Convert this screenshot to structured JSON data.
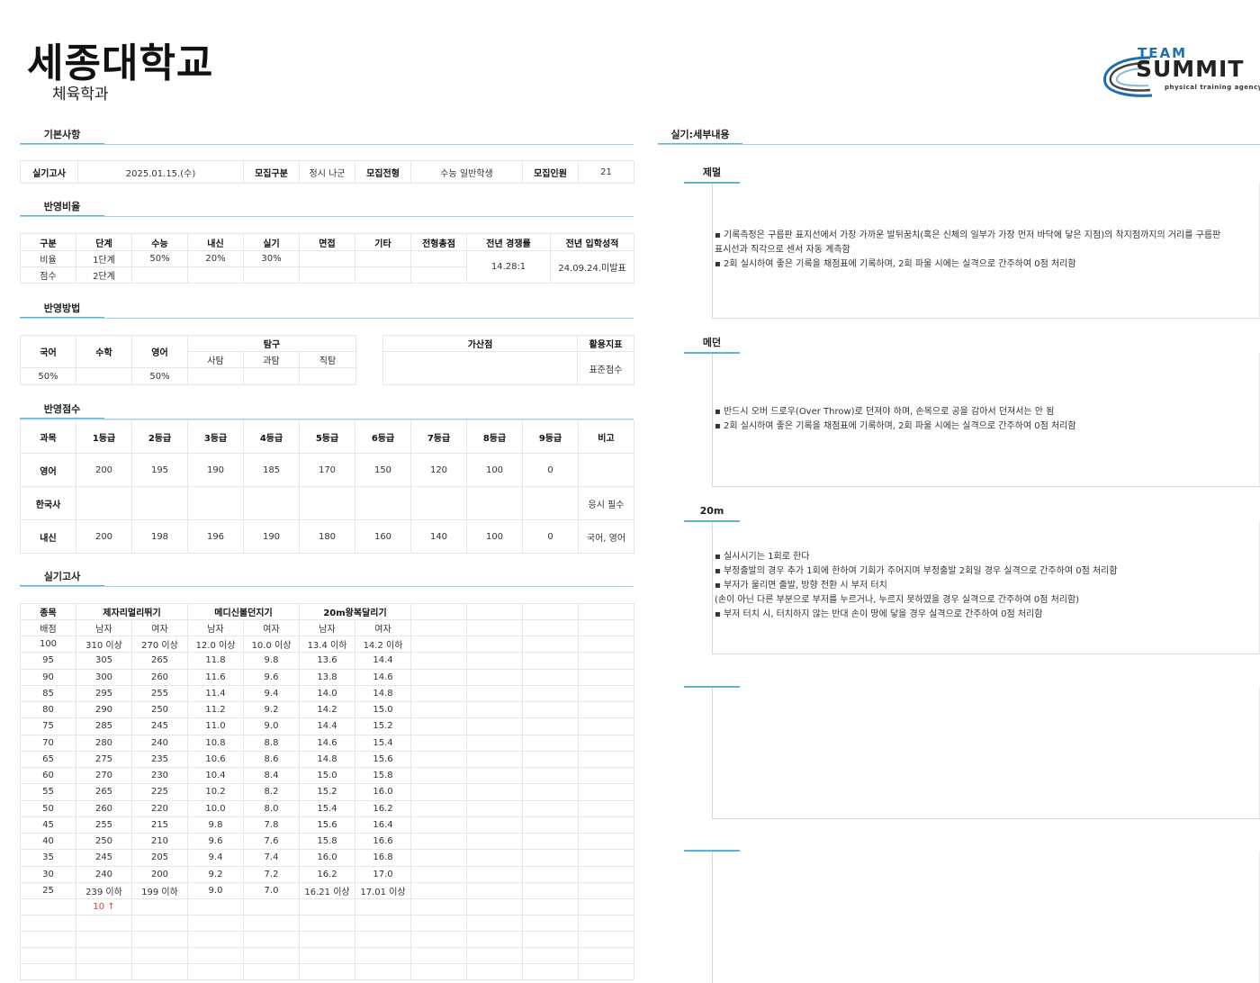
{
  "header": {
    "university": "세종대학교",
    "department": "체육학과"
  },
  "logo": {
    "team": "TEAM",
    "summit": "SUMMIT",
    "sub": "physical training agency"
  },
  "basic": {
    "title": "기본사항",
    "exam_date_label": "실기고사",
    "exam_date": "2025.01.15.(수)",
    "recruit_type_label": "모집구분",
    "recruit_type": "정시 나군",
    "recruit_track_label": "모집전형",
    "recruit_track": "수능 일반학생",
    "recruit_num_label": "모집인원",
    "recruit_num": "21"
  },
  "ratio": {
    "title": "반영비율",
    "headers": [
      "구분",
      "단계",
      "수능",
      "내신",
      "실기",
      "면접",
      "기타",
      "전형총점",
      "전년 경쟁률",
      "전년 입학성적"
    ],
    "row1": [
      "비율",
      "1단계",
      "50%",
      "20%",
      "30%",
      "",
      "",
      ""
    ],
    "row2": [
      "점수",
      "2단계",
      "",
      "",
      "",
      "",
      "",
      ""
    ],
    "prev_competition": "14.28:1",
    "prev_score": "24.09.24.미발표"
  },
  "method": {
    "title": "반영방법",
    "korean": "국어",
    "math": "수학",
    "english": "영어",
    "inquiry": "탐구",
    "social": "사탐",
    "science": "과탐",
    "vocational": "직탐",
    "bonus": "가산점",
    "indicator": "활용지표",
    "korean_val": "50%",
    "english_val": "50%",
    "indicator_val": "표준점수"
  },
  "scores": {
    "title": "반영점수",
    "headers": [
      "과목",
      "1등급",
      "2등급",
      "3등급",
      "4등급",
      "5등급",
      "6등급",
      "7등급",
      "8등급",
      "9등급",
      "비고"
    ],
    "rows": [
      [
        "영어",
        "200",
        "195",
        "190",
        "185",
        "170",
        "150",
        "120",
        "100",
        "0",
        ""
      ],
      [
        "한국사",
        "",
        "",
        "",
        "",
        "",
        "",
        "",
        "",
        "",
        "응시 필수"
      ],
      [
        "내신",
        "200",
        "198",
        "196",
        "190",
        "180",
        "160",
        "140",
        "100",
        "0",
        "국어, 영어"
      ]
    ]
  },
  "practical": {
    "title": "실기고사",
    "event_label": "종목",
    "events": [
      "제자리멀리뛰기",
      "메디신볼던지기",
      "20m왕복달리기"
    ],
    "score_label": "배점",
    "male": "남자",
    "female": "여자",
    "rows": [
      [
        "100",
        "310 이상",
        "270 이상",
        "12.0 이상",
        "10.0 이상",
        "13.4 이하",
        "14.2 이하"
      ],
      [
        "95",
        "305",
        "265",
        "11.8",
        "9.8",
        "13.6",
        "14.4"
      ],
      [
        "90",
        "300",
        "260",
        "11.6",
        "9.6",
        "13.8",
        "14.6"
      ],
      [
        "85",
        "295",
        "255",
        "11.4",
        "9.4",
        "14.0",
        "14.8"
      ],
      [
        "80",
        "290",
        "250",
        "11.2",
        "9.2",
        "14.2",
        "15.0"
      ],
      [
        "75",
        "285",
        "245",
        "11.0",
        "9.0",
        "14.4",
        "15.2"
      ],
      [
        "70",
        "280",
        "240",
        "10.8",
        "8.8",
        "14.6",
        "15.4"
      ],
      [
        "65",
        "275",
        "235",
        "10.6",
        "8.6",
        "14.8",
        "15.6"
      ],
      [
        "60",
        "270",
        "230",
        "10.4",
        "8.4",
        "15.0",
        "15.8"
      ],
      [
        "55",
        "265",
        "225",
        "10.2",
        "8.2",
        "15.2",
        "16.0"
      ],
      [
        "50",
        "260",
        "220",
        "10.0",
        "8.0",
        "15.4",
        "16.2"
      ],
      [
        "45",
        "255",
        "215",
        "9.8",
        "7.8",
        "15.6",
        "16.4"
      ],
      [
        "40",
        "250",
        "210",
        "9.6",
        "7.6",
        "15.8",
        "16.6"
      ],
      [
        "35",
        "245",
        "205",
        "9.4",
        "7.4",
        "16.0",
        "16.8"
      ],
      [
        "30",
        "240",
        "200",
        "9.2",
        "7.2",
        "16.2",
        "17.0"
      ],
      [
        "25",
        "239 이하",
        "199 이하",
        "9.0",
        "7.0",
        "16.21 이상",
        "17.01 이상"
      ]
    ],
    "note": "10 ↑"
  },
  "details": {
    "title": "실기:세부내용",
    "jump": {
      "title": "제멀",
      "lines": [
        "▪ 기록측정은 구름판 표지선에서 가장 가까운 발뒤꿈치(혹은 신체의 일부가 가장 먼저 바닥에  닿은 지점)의 착지점까지의 거리를 구름판",
        "표시선과 직각으로 센서 자동 계측함",
        " ▪ 2회 실시하여 좋은 기록을 채점표에 기록하며, 2회 파울 시에는 실격으로 간주하여 0점 처리함"
      ]
    },
    "medball": {
      "title": "메던",
      "lines": [
        " ▪ 반드시 오버 드로우(Over Throw)로 던져야 하며, 손목으로 공을 감아서 던져서는 안 됨",
        " ▪ 2회 실시하여 좋은 기록을 채점표에 기록하며, 2회 파울 시에는 실격으로 간주하여 0점 처리함"
      ]
    },
    "shuttle": {
      "title": "20m",
      "lines": [
        "▪ 실시시기는 1회로 한다",
        "▪ 부정출발의 경우 추가 1회에 한하여 기회가 주어지며 부정출발 2회일 경우 실격으로 간주하여 0점 처리함",
        "▪ 부저가 울리면 출발, 방향 전환 시 부저 터치",
        " (손이 아닌 다른 부분으로 부저를 누르거나, 누르지 못하였을 경우 실격으로 간주하여 0점 처리함)",
        "▪ 부저 터치 시, 터치하지 않는 반대 손이 땅에 닿을 경우 실격으로 간주하여 0점 처리함"
      ]
    }
  },
  "colors": {
    "accent": "#5fb3d6",
    "note": "#e53935",
    "logo_blue": "#1e6fb0"
  }
}
